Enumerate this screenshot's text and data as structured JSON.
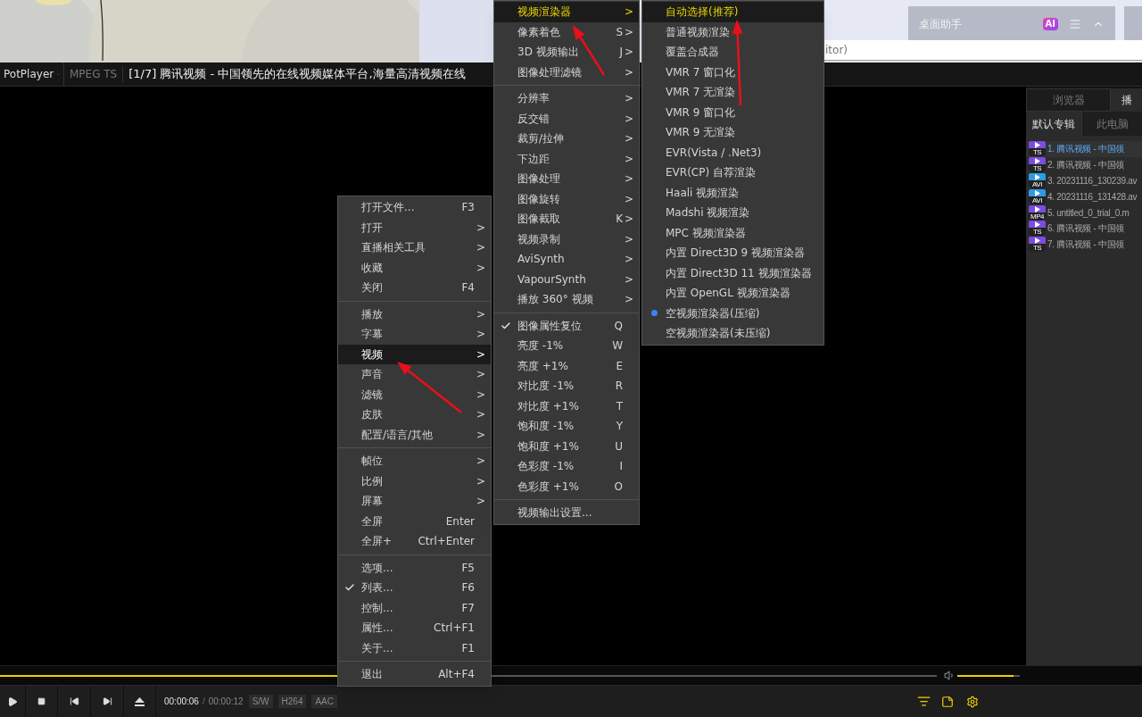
{
  "desktop_widget": {
    "title": "桌面助手",
    "badge": "AI"
  },
  "address_bar": {
    "text": "itor)"
  },
  "title_bar": {
    "app": "PotPlayer",
    "format": "MPEG TS",
    "title": "[1/7] 腾讯视频 - 中国领先的在线视频媒体平台,海量高清视频在线"
  },
  "menus": [
    {
      "kind": "check",
      "groups": [
        {
          "items": [
            {
              "label": "打开文件...",
              "shortcut": "F3",
              "selected": false,
              "checked": false
            },
            {
              "label": "打开",
              "arrow": ">",
              "selected": false,
              "checked": false
            },
            {
              "label": "直播相关工具",
              "arrow": ">",
              "selected": false,
              "checked": false
            },
            {
              "label": "收藏",
              "arrow": ">",
              "selected": false,
              "checked": false
            },
            {
              "label": "关闭",
              "shortcut": "F4",
              "selected": false,
              "checked": false
            }
          ]
        },
        {
          "items": [
            {
              "label": "播放",
              "arrow": ">",
              "selected": false,
              "checked": false
            },
            {
              "label": "字幕",
              "arrow": ">",
              "selected": false,
              "checked": false
            },
            {
              "label": "视频",
              "arrow": ">",
              "selected": true,
              "checked": false
            },
            {
              "label": "声音",
              "arrow": ">",
              "selected": false,
              "checked": false
            },
            {
              "label": "滤镜",
              "arrow": ">",
              "selected": false,
              "checked": false
            },
            {
              "label": "皮肤",
              "arrow": ">",
              "selected": false,
              "checked": false
            },
            {
              "label": "配置/语言/其他",
              "arrow": ">",
              "selected": false,
              "checked": false
            }
          ]
        },
        {
          "items": [
            {
              "label": "帧位",
              "arrow": ">",
              "selected": false,
              "checked": false
            },
            {
              "label": "比例",
              "arrow": ">",
              "selected": false,
              "checked": false
            },
            {
              "label": "屏幕",
              "arrow": ">",
              "selected": false,
              "checked": false
            },
            {
              "label": "全屏",
              "shortcut": "Enter",
              "selected": false,
              "checked": false
            },
            {
              "label": "全屏+",
              "shortcut": "Ctrl+Enter",
              "selected": false,
              "checked": false
            }
          ]
        },
        {
          "items": [
            {
              "label": "选项...",
              "shortcut": "F5",
              "selected": false,
              "checked": false
            },
            {
              "label": "列表...",
              "shortcut": "F6",
              "selected": false,
              "checked": true
            },
            {
              "label": "控制...",
              "shortcut": "F7",
              "selected": false,
              "checked": false
            },
            {
              "label": "属性...",
              "shortcut": "Ctrl+F1",
              "selected": false,
              "checked": false
            },
            {
              "label": "关于...",
              "shortcut": "F1",
              "selected": false,
              "checked": false
            }
          ]
        },
        {
          "items": [
            {
              "label": "退出",
              "shortcut": "Alt+F4",
              "selected": false,
              "checked": false
            }
          ]
        }
      ]
    },
    {
      "kind": "check",
      "groups": [
        {
          "items": [
            {
              "label": "视频渲染器",
              "arrow": ">",
              "selected": true,
              "checked": false
            },
            {
              "label": "像素着色",
              "shortcut": "S",
              "arrow": ">",
              "selected": false,
              "checked": false
            },
            {
              "label": "3D 视频输出",
              "shortcut": "J",
              "arrow": ">",
              "selected": false,
              "checked": false
            },
            {
              "label": "图像处理滤镜",
              "arrow": ">",
              "selected": false,
              "checked": false
            }
          ]
        },
        {
          "items": [
            {
              "label": "分辨率",
              "arrow": ">",
              "selected": false,
              "checked": false
            },
            {
              "label": "反交错",
              "arrow": ">",
              "selected": false,
              "checked": false
            },
            {
              "label": "裁剪/拉伸",
              "arrow": ">",
              "selected": false,
              "checked": false
            },
            {
              "label": "下边距",
              "arrow": ">",
              "selected": false,
              "checked": false
            },
            {
              "label": "图像处理",
              "arrow": ">",
              "selected": false,
              "checked": false
            },
            {
              "label": "图像旋转",
              "arrow": ">",
              "selected": false,
              "checked": false
            },
            {
              "label": "图像截取",
              "shortcut": "K",
              "arrow": ">",
              "selected": false,
              "checked": false
            },
            {
              "label": "视频录制",
              "arrow": ">",
              "selected": false,
              "checked": false
            },
            {
              "label": "AviSynth",
              "arrow": ">",
              "selected": false,
              "checked": false
            },
            {
              "label": "VapourSynth",
              "arrow": ">",
              "selected": false,
              "checked": false
            },
            {
              "label": "播放 360° 视频",
              "arrow": ">",
              "selected": false,
              "checked": false
            }
          ]
        },
        {
          "items": [
            {
              "label": "图像属性复位",
              "shortcut": "Q",
              "selected": false,
              "checked": true
            },
            {
              "label": "亮度 -1%",
              "shortcut": "W",
              "selected": false,
              "checked": false
            },
            {
              "label": "亮度 +1%",
              "shortcut": "E",
              "selected": false,
              "checked": false
            },
            {
              "label": "对比度 -1%",
              "shortcut": "R",
              "selected": false,
              "checked": false
            },
            {
              "label": "对比度 +1%",
              "shortcut": "T",
              "selected": false,
              "checked": false
            },
            {
              "label": "饱和度 -1%",
              "shortcut": "Y",
              "selected": false,
              "checked": false
            },
            {
              "label": "饱和度 +1%",
              "shortcut": "U",
              "selected": false,
              "checked": false
            },
            {
              "label": "色彩度 -1%",
              "shortcut": "I",
              "selected": false,
              "checked": false
            },
            {
              "label": "色彩度 +1%",
              "shortcut": "O",
              "selected": false,
              "checked": false
            }
          ]
        },
        {
          "items": [
            {
              "label": "视频输出设置...",
              "selected": false,
              "checked": false
            }
          ]
        }
      ]
    },
    {
      "kind": "radio",
      "groups": [
        {
          "items": [
            {
              "label": "自动选择(推荐)",
              "selected": true,
              "checked": false
            },
            {
              "label": "普通视频渲染",
              "selected": false,
              "checked": false
            },
            {
              "label": "覆盖合成器",
              "selected": false,
              "checked": false
            },
            {
              "label": "VMR 7 窗口化",
              "selected": false,
              "checked": false
            },
            {
              "label": "VMR 7 无渲染",
              "selected": false,
              "checked": false
            },
            {
              "label": "VMR 9 窗口化",
              "selected": false,
              "checked": false
            },
            {
              "label": "VMR 9 无渲染",
              "selected": false,
              "checked": false
            },
            {
              "label": "EVR(Vista / .Net3)",
              "selected": false,
              "checked": false
            },
            {
              "label": "EVR(CP) 自荐渲染",
              "selected": false,
              "checked": false
            },
            {
              "label": "Haali 视频渲染",
              "selected": false,
              "checked": false
            },
            {
              "label": "Madshi 视频渲染",
              "selected": false,
              "checked": false
            },
            {
              "label": "MPC 视频渲染器",
              "selected": false,
              "checked": false
            },
            {
              "label": "内置 Direct3D 9 视频渲染器",
              "selected": false,
              "checked": false
            },
            {
              "label": "内置 Direct3D 11 视频渲染器",
              "selected": false,
              "checked": false
            },
            {
              "label": "内置 OpenGL 视频渲染器",
              "selected": false,
              "checked": false
            },
            {
              "label": "空视频渲染器(压缩)",
              "selected": false,
              "checked": true
            },
            {
              "label": "空视频渲染器(未压缩)",
              "selected": false,
              "checked": false
            }
          ]
        }
      ]
    }
  ],
  "playlist_panel": {
    "tabs": [
      {
        "label": "浏览器",
        "selected": false
      },
      {
        "label": "播",
        "selected": true
      }
    ],
    "subtabs": [
      {
        "label": "默认专辑",
        "selected": true
      },
      {
        "label": "此电脑",
        "selected": false
      }
    ],
    "items": [
      {
        "format": "TS",
        "label": "1. 腾讯视频 - 中国领",
        "color": "#7a4de0",
        "selected": true
      },
      {
        "format": "TS",
        "label": "2. 腾讯视频 - 中国领",
        "color": "#7a4de0",
        "selected": false
      },
      {
        "format": "AVI",
        "label": "3. 20231116_130239.av",
        "color": "#2c9ce8",
        "selected": false
      },
      {
        "format": "AVI",
        "label": "4. 20231116_131428.av",
        "color": "#2c9ce8",
        "selected": false
      },
      {
        "format": "MP4",
        "label": "5. untitled_0_trial_0.m",
        "color": "#7a4de0",
        "selected": false
      },
      {
        "format": "TS",
        "label": "6. 腾讯视频 - 中国领",
        "color": "#7a4de0",
        "selected": false
      },
      {
        "format": "TS",
        "label": "7. 腾讯视频 - 中国领",
        "color": "#7a4de0",
        "selected": false
      }
    ]
  },
  "seek_bar": {
    "level": 0.5
  },
  "volume": {
    "level": 0.9
  },
  "controls": {
    "elapsed": "00:00:06",
    "separator": "/",
    "duration": "00:00:12",
    "badges": [
      "S/W",
      "H264",
      "AAC"
    ]
  }
}
